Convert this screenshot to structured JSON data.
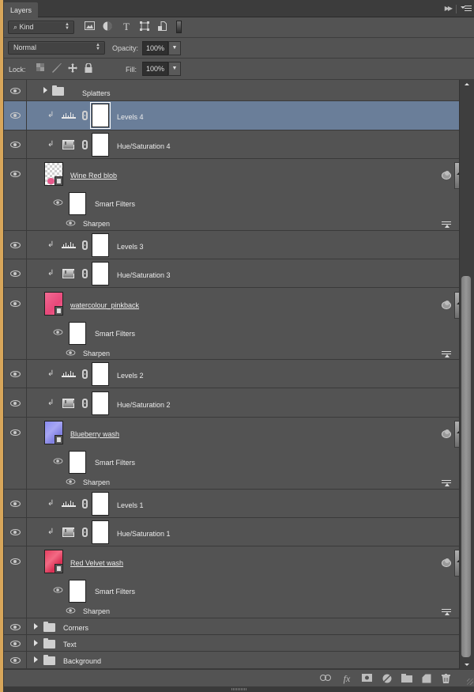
{
  "panel": {
    "tab_label": "Layers",
    "collapse_icon": "double-chevron-right-icon",
    "menu_icon": "panel-menu-icon"
  },
  "filter": {
    "kind_label": "Kind",
    "kind_icon": "search-icon",
    "filter_icons": [
      "pixel-layer-filter-icon",
      "adjustment-layer-filter-icon",
      "type-layer-filter-icon",
      "shape-layer-filter-icon",
      "smart-object-filter-icon"
    ],
    "type_glyph": "T"
  },
  "blend": {
    "mode": "Normal",
    "opacity_label": "Opacity:",
    "opacity_value": "100%",
    "lock_label": "Lock:",
    "fill_label": "Fill:",
    "fill_value": "100%"
  },
  "layers": [
    {
      "type": "group",
      "name": "Splatters",
      "visible": true,
      "nested": true
    },
    {
      "type": "adjustment",
      "adjustment": "levels",
      "name": "Levels 4",
      "visible": true,
      "clipped": true,
      "selected": true
    },
    {
      "type": "adjustment",
      "adjustment": "hue-saturation",
      "name": "Hue/Saturation 4",
      "visible": true,
      "clipped": true
    },
    {
      "type": "smart-object",
      "name": "Wine Red blob",
      "visible": true,
      "thumb": "wine",
      "smart_filters_label": "Smart Filters",
      "filter": "Sharpen"
    },
    {
      "type": "adjustment",
      "adjustment": "levels",
      "name": "Levels 3",
      "visible": true,
      "clipped": true
    },
    {
      "type": "adjustment",
      "adjustment": "hue-saturation",
      "name": "Hue/Saturation 3",
      "visible": true,
      "clipped": true
    },
    {
      "type": "smart-object",
      "name": "watercolour_pinkback",
      "visible": true,
      "thumb": "pink",
      "smart_filters_label": "Smart Filters",
      "filter": "Sharpen"
    },
    {
      "type": "adjustment",
      "adjustment": "levels",
      "name": "Levels 2",
      "visible": true,
      "clipped": true
    },
    {
      "type": "adjustment",
      "adjustment": "hue-saturation",
      "name": "Hue/Saturation 2",
      "visible": true,
      "clipped": true
    },
    {
      "type": "smart-object",
      "name": "Blueberry wash",
      "visible": true,
      "thumb": "blue",
      "smart_filters_label": "Smart Filters",
      "filter": "Sharpen"
    },
    {
      "type": "adjustment",
      "adjustment": "levels",
      "name": "Levels 1",
      "visible": true,
      "clipped": true
    },
    {
      "type": "adjustment",
      "adjustment": "hue-saturation",
      "name": "Hue/Saturation 1",
      "visible": true,
      "clipped": true
    },
    {
      "type": "smart-object",
      "name": "Red Velvet wash",
      "visible": true,
      "thumb": "red",
      "smart_filters_label": "Smart Filters",
      "filter": "Sharpen"
    },
    {
      "type": "group",
      "name": "Corners",
      "visible": true
    },
    {
      "type": "group",
      "name": "Text",
      "visible": true
    },
    {
      "type": "group",
      "name": "Background",
      "visible": true
    }
  ],
  "footer": {
    "buttons": [
      "link-layers-icon",
      "fx-icon",
      "add-mask-icon",
      "new-adjustment-icon",
      "new-group-icon",
      "new-layer-icon",
      "delete-icon"
    ],
    "fx_label": "fx"
  },
  "colors": {
    "panel_bg": "#535353",
    "selected_row": "#6a7e99"
  }
}
